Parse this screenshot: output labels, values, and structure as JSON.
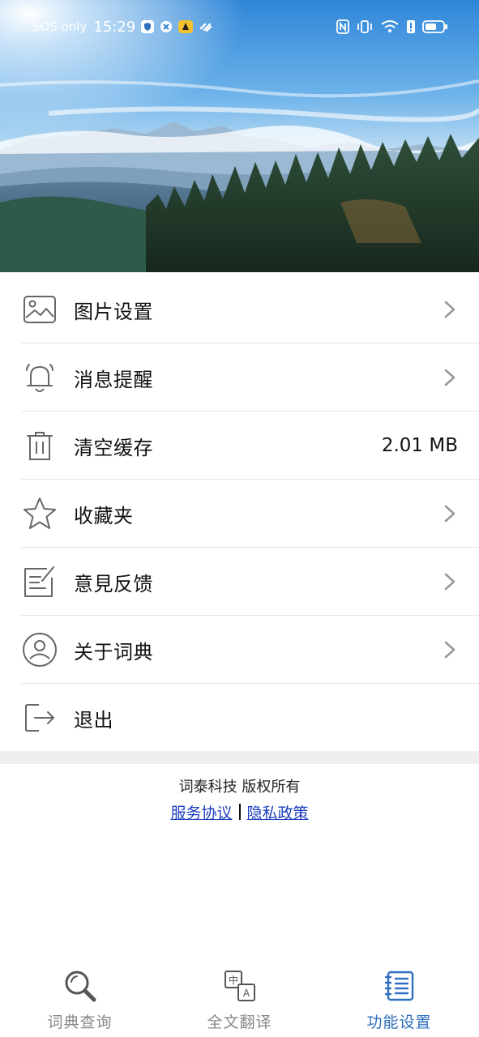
{
  "status_bar": {
    "carrier": "SOS only",
    "time": "15:29"
  },
  "menu": {
    "items": [
      {
        "label": "图片设置",
        "icon": "image-icon",
        "trailing": "chevron"
      },
      {
        "label": "消息提醒",
        "icon": "bell-icon",
        "trailing": "chevron"
      },
      {
        "label": "清空缓存",
        "icon": "trash-icon",
        "trailing": "value",
        "value": "2.01 MB"
      },
      {
        "label": "收藏夹",
        "icon": "star-icon",
        "trailing": "chevron"
      },
      {
        "label": "意見反馈",
        "icon": "feedback-icon",
        "trailing": "chevron"
      },
      {
        "label": "关于词典",
        "icon": "user-circle-icon",
        "trailing": "chevron"
      },
      {
        "label": "退出",
        "icon": "logout-icon",
        "trailing": "none"
      }
    ]
  },
  "footer": {
    "copyright": "词泰科技 版权所有",
    "terms_link": "服务协议",
    "privacy_link": "隐私政策"
  },
  "bottom_nav": {
    "items": [
      {
        "label": "词典查询",
        "icon": "search-icon",
        "active": false
      },
      {
        "label": "全文翻译",
        "icon": "translate-icon",
        "active": false
      },
      {
        "label": "功能设置",
        "icon": "notebook-icon",
        "active": true
      }
    ]
  },
  "colors": {
    "accent": "#2f6fbf",
    "link": "#1a3dbf",
    "divider": "#e6e6e6"
  }
}
